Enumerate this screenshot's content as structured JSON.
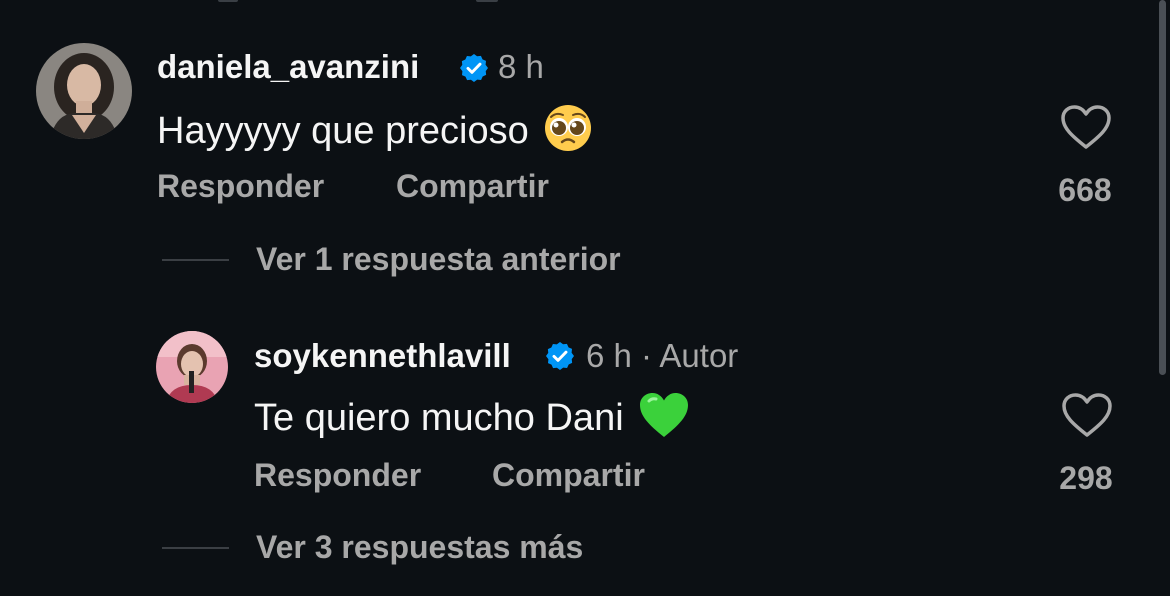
{
  "comments": [
    {
      "username": "daniela_avanzini",
      "time": "8 h",
      "text": "Hayyyyy que precioso",
      "emoji": "pleading-face",
      "reply_label": "Responder",
      "share_label": "Compartir",
      "likes": "668"
    }
  ],
  "view_previous": "Ver 1 respuesta anterior",
  "reply": {
    "username": "soykennethlavill",
    "time": "6 h",
    "separator": "·",
    "author_tag": "Autor",
    "text": "Te quiero mucho Dani",
    "emoji": "green-heart",
    "reply_label": "Responder",
    "share_label": "Compartir",
    "likes": "298"
  },
  "view_more": "Ver 3 respuestas más",
  "colors": {
    "background": "#0c1014",
    "primary_text": "#f5f5f5",
    "secondary_text": "#a8a8a8",
    "verified_blue": "#0095f6",
    "green_heart": "#3bd13b"
  }
}
